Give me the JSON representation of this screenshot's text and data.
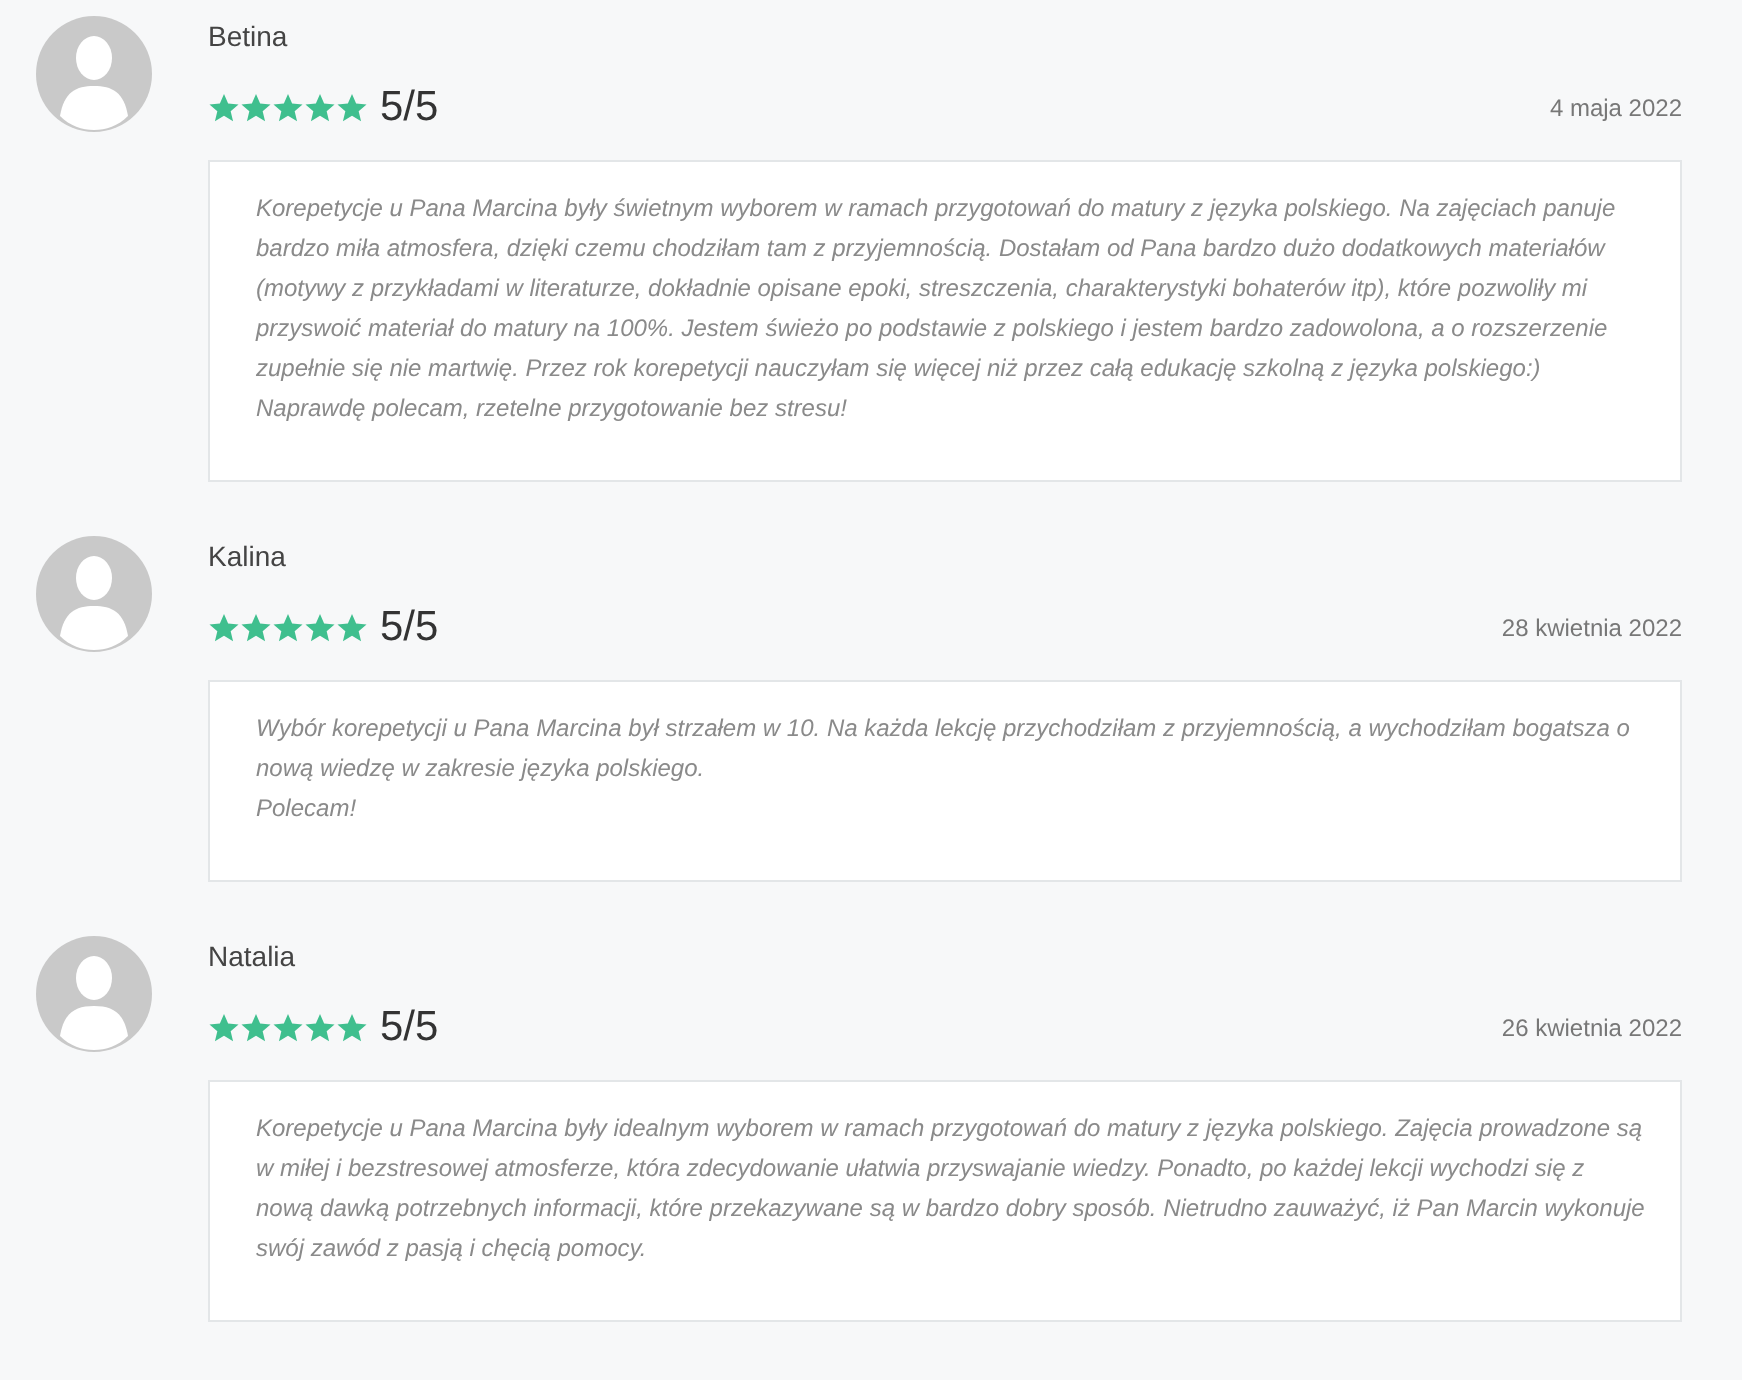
{
  "reviews": [
    {
      "author": "Betina",
      "stars": 5,
      "score": "5/5",
      "date": "4 maja 2022",
      "paragraphs": [
        "Korepetycje u Pana Marcina były świetnym wyborem w ramach przygotowań do matury z języka polskiego. Na zajęciach panuje bardzo miła atmosfera, dzięki czemu chodziłam tam z przyjemnością. Dostałam od Pana bardzo dużo dodatkowych materiałów (motywy z przykładami w literaturze, dokładnie opisane epoki, streszczenia, charakterystyki bohaterów itp), które pozwoliły mi przyswoić materiał do matury na 100%. Jestem świeżo po podstawie z polskiego i jestem bardzo zadowolona, a o rozszerzenie zupełnie się nie martwię. Przez rok korepetycji nauczyłam się więcej niż przez całą edukację szkolną z języka polskiego:) Naprawdę polecam, rzetelne przygotowanie bez stresu!"
      ]
    },
    {
      "author": "Kalina",
      "stars": 5,
      "score": "5/5",
      "date": "28 kwietnia 2022",
      "paragraphs": [
        "Wybór korepetycji u Pana Marcina był strzałem w 10. Na każda lekcję przychodziłam z przyjemnością, a wychodziłam bogatsza o nową wiedzę w zakresie języka polskiego.",
        "Polecam!"
      ]
    },
    {
      "author": "Natalia",
      "stars": 5,
      "score": "5/5",
      "date": "26 kwietnia 2022",
      "paragraphs": [
        "Korepetycje u Pana Marcina były idealnym wyborem w ramach przygotowań do matury z języka polskiego. Zajęcia prowadzone są w miłej i bezstresowej atmosferze, która zdecydowanie ułatwia przyswajanie wiedzy. Ponadto, po każdej lekcji wychodzi się z nową dawką potrzebnych informacji, które przekazywane są w bardzo dobry sposób. Nietrudno zauważyć, iż Pan Marcin wykonuje swój zawód z pasją i chęcią pomocy."
      ]
    }
  ]
}
